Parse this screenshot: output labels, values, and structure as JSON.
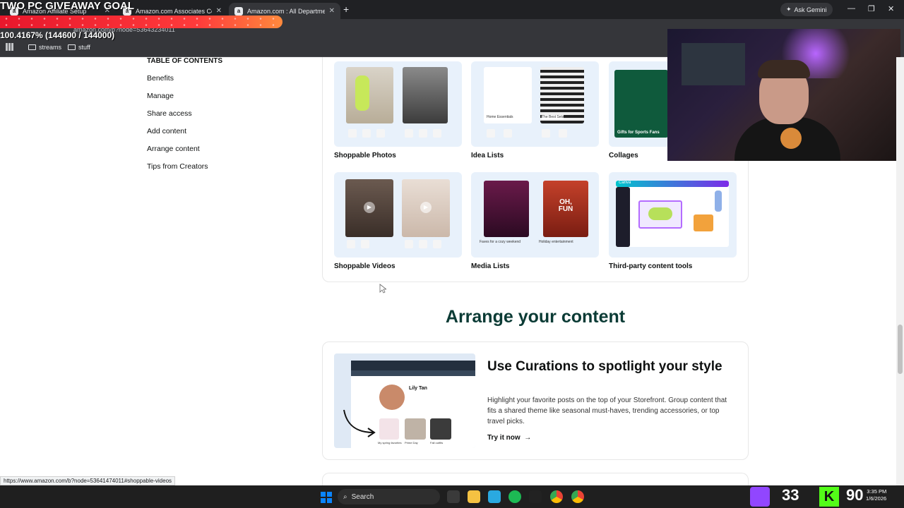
{
  "browser": {
    "tabs": [
      {
        "title": "Amazon Affiliate Setup",
        "active": false
      },
      {
        "title": "Amazon.com Associates Centre",
        "active": false
      },
      {
        "title": "Amazon.com : All Departments",
        "active": true
      }
    ],
    "new_tab": "+",
    "ask_gemini": "Ask Gemini",
    "url": "amazon.com/b?node=53643234011",
    "bookmarks": [
      "streams",
      "stuff"
    ]
  },
  "overlay": {
    "goal_title": "TWO PC GIVEAWAY GOAL",
    "goal_progress_text": "100.4167% (144600 / 144000)",
    "goal_fraction": 1.0
  },
  "toc": {
    "title": "TABLE OF CONTENTS",
    "items": [
      "Benefits",
      "Manage",
      "Share access",
      "Add content",
      "Arrange content",
      "Tips from Creators"
    ]
  },
  "content_types": [
    {
      "label": "Shoppable Photos"
    },
    {
      "label": "Idea Lists"
    },
    {
      "label": "Collages"
    },
    {
      "label": "Shoppable Videos"
    },
    {
      "label": "Media Lists"
    },
    {
      "label": "Third-party content tools"
    }
  ],
  "tile_text": {
    "idea_home": "Home Essentials",
    "idea_sets": "The Best Sets",
    "collage": "Gifts for Sports Fans",
    "media_left_title": "Faves for a cozy weekend",
    "media_right_title": "Holiday entertainment",
    "media_right_poster": "OH, FUN",
    "canva": "Canva"
  },
  "arrange": {
    "heading": "Arrange your content",
    "card_title": "Use Curations to spotlight your style",
    "card_body": "Highlight your favorite posts on the top of your Storefront. Group content that fits a shared theme like seasonal must-haves, trending accessories, or top travel picks.",
    "cta": "Try it now",
    "mock_profile_name": "Lily Tan",
    "mock_captions": [
      "My spring favorites",
      "Prime Day",
      "Fall outfits"
    ]
  },
  "status_bar_url": "https://www.amazon.com/b?node=53641474011#shoppable-videos",
  "taskbar": {
    "search": "Search",
    "twitch_count": "33",
    "kick_count": "90",
    "time": "3:35 PM",
    "date": "1/6/2026"
  },
  "colors": {
    "heading_green": "#0b3b35",
    "tile_bg": "#e8f1fb",
    "chrome_dark": "#202124",
    "goal_red": "#e8172c"
  }
}
